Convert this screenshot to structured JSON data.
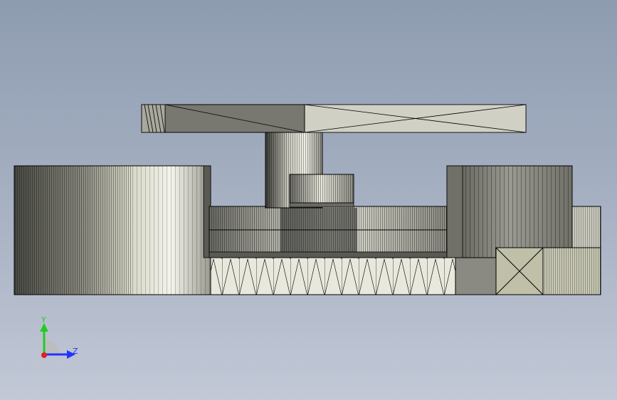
{
  "viewport": {
    "background_top": "#8e9cb0",
    "background_bottom": "#c2c8d6"
  },
  "model": {
    "edge_color": "#000000",
    "face_colors": {
      "light": "#e6e6d6",
      "mid": "#b8b8a8",
      "dark": "#6e6e66",
      "darkest": "#404040"
    }
  },
  "triad": {
    "y_label": "Y",
    "z_label": "Z",
    "y_color": "#22cc22",
    "z_color": "#2233ff",
    "origin_color": "#dd2222"
  }
}
